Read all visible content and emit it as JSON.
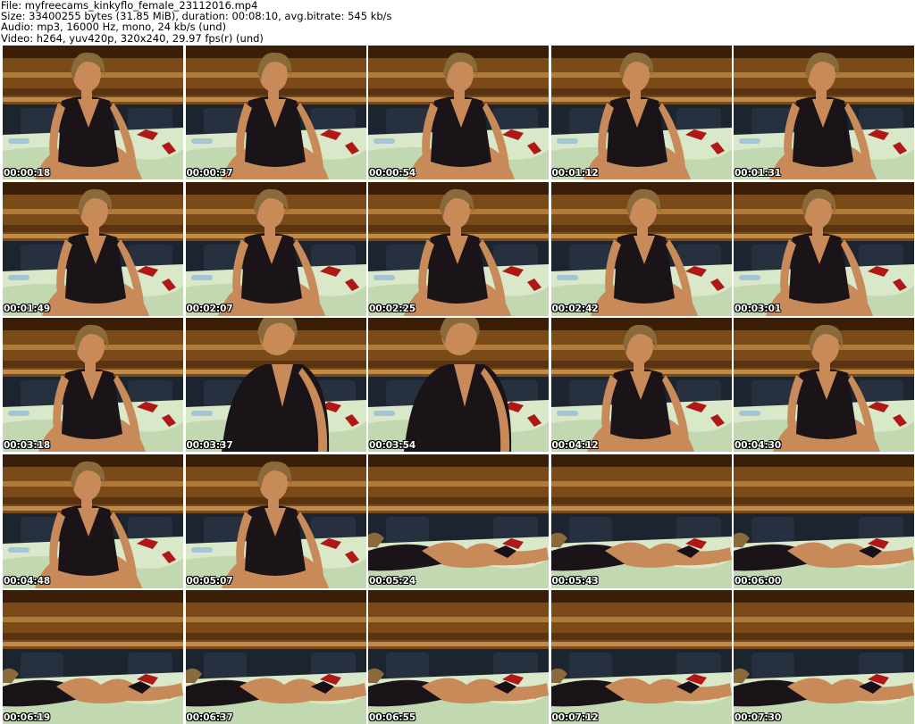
{
  "header": {
    "file_line": "File: myfreecams_kinkyflo_female_23112016.mp4",
    "size_line": "Size: 33400255 bytes (31.85 MiB), duration: 00:08:10, avg.bitrate: 545 kb/s",
    "audio_line": "Audio: mp3, 16000 Hz, mono, 24 kb/s (und)",
    "video_line": "Video: h264, yuv420p, 320x240, 29.97 fps(r) (und)"
  },
  "colors": {
    "wall_wood": "#7a4a18",
    "wall_dark": "#3a1e08",
    "headboard": "#1c2430",
    "sheet": "#d8e8c8",
    "skin": "#c88a58",
    "dress": "#1a1418",
    "hair": "#8a6a3a",
    "accent_red": "#b01818"
  },
  "thumbnails": [
    {
      "time": "00:00:18",
      "pose": "sit"
    },
    {
      "time": "00:00:37",
      "pose": "sit"
    },
    {
      "time": "00:00:54",
      "pose": "sit"
    },
    {
      "time": "00:01:12",
      "pose": "sit"
    },
    {
      "time": "00:01:31",
      "pose": "sit"
    },
    {
      "time": "00:01:49",
      "pose": "sit"
    },
    {
      "time": "00:02:07",
      "pose": "sit"
    },
    {
      "time": "00:02:25",
      "pose": "sit"
    },
    {
      "time": "00:02:42",
      "pose": "sit"
    },
    {
      "time": "00:03:01",
      "pose": "sit"
    },
    {
      "time": "00:03:18",
      "pose": "sit"
    },
    {
      "time": "00:03:37",
      "pose": "close"
    },
    {
      "time": "00:03:54",
      "pose": "close"
    },
    {
      "time": "00:04:12",
      "pose": "sit"
    },
    {
      "time": "00:04:30",
      "pose": "sit"
    },
    {
      "time": "00:04:48",
      "pose": "sit"
    },
    {
      "time": "00:05:07",
      "pose": "sit"
    },
    {
      "time": "00:05:24",
      "pose": "lie"
    },
    {
      "time": "00:05:43",
      "pose": "lie"
    },
    {
      "time": "00:06:00",
      "pose": "lie"
    },
    {
      "time": "00:06:19",
      "pose": "lie"
    },
    {
      "time": "00:06:37",
      "pose": "lie"
    },
    {
      "time": "00:06:55",
      "pose": "lie"
    },
    {
      "time": "00:07:12",
      "pose": "lie"
    },
    {
      "time": "00:07:30",
      "pose": "lie"
    }
  ]
}
